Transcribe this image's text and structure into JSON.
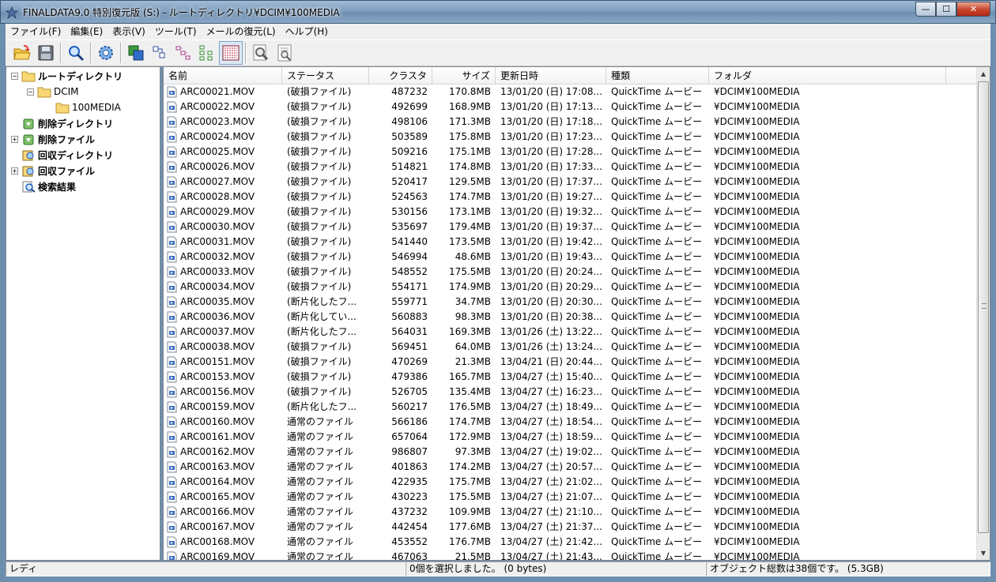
{
  "window": {
    "title": "FINALDATA9.0 特別復元版 (S:) - ルートディレクトリ¥DCIM¥100MEDIA",
    "controls": {
      "minimize": "—",
      "maximize": "☐",
      "close": "✕"
    }
  },
  "menu": [
    "ファイル(F)",
    "編集(E)",
    "表示(V)",
    "ツール(T)",
    "メールの復元(L)",
    "ヘルプ(H)"
  ],
  "toolbar": [
    {
      "icon": "open-folder-icon"
    },
    {
      "icon": "save-disk-icon"
    },
    {
      "icon": "search-magnifier-icon"
    },
    {
      "icon": "settings-gear-icon"
    },
    {
      "icon": "large-icons-view-icon"
    },
    {
      "icon": "small-icons-view-icon"
    },
    {
      "icon": "list-view-icon"
    },
    {
      "icon": "tree-view-icon"
    },
    {
      "icon": "details-view-icon"
    },
    {
      "icon": "preview-magnifier-icon"
    },
    {
      "icon": "file-preview-icon"
    }
  ],
  "tree": [
    {
      "label": "ルートディレクトリ",
      "expander": "−",
      "icon": "folder-icon"
    },
    {
      "label": "DCIM",
      "expander": "−",
      "icon": "folder-icon"
    },
    {
      "label": "100MEDIA",
      "expander": "",
      "icon": "folder-icon"
    },
    {
      "label": "削除ディレクトリ",
      "expander": "",
      "icon": "recycle-icon"
    },
    {
      "label": "削除ファイル",
      "expander": "+",
      "icon": "recycle-icon"
    },
    {
      "label": "回収ディレクトリ",
      "expander": "",
      "icon": "recover-icon"
    },
    {
      "label": "回収ファイル",
      "expander": "+",
      "icon": "recover-icon"
    },
    {
      "label": "検索結果",
      "expander": "",
      "icon": "search-result-icon"
    }
  ],
  "columns": [
    "名前",
    "ステータス",
    "クラスタ",
    "サイズ",
    "更新日時",
    "種類",
    "フォルダ"
  ],
  "rows": [
    [
      "ARC00021.MOV",
      "(破損ファイル)",
      "487232",
      "170.8MB",
      "13/01/20 (日) 17:08...",
      "QuickTime ムービー",
      "¥DCIM¥100MEDIA"
    ],
    [
      "ARC00022.MOV",
      "(破損ファイル)",
      "492699",
      "168.9MB",
      "13/01/20 (日) 17:13...",
      "QuickTime ムービー",
      "¥DCIM¥100MEDIA"
    ],
    [
      "ARC00023.MOV",
      "(破損ファイル)",
      "498106",
      "171.3MB",
      "13/01/20 (日) 17:18...",
      "QuickTime ムービー",
      "¥DCIM¥100MEDIA"
    ],
    [
      "ARC00024.MOV",
      "(破損ファイル)",
      "503589",
      "175.8MB",
      "13/01/20 (日) 17:23...",
      "QuickTime ムービー",
      "¥DCIM¥100MEDIA"
    ],
    [
      "ARC00025.MOV",
      "(破損ファイル)",
      "509216",
      "175.1MB",
      "13/01/20 (日) 17:28...",
      "QuickTime ムービー",
      "¥DCIM¥100MEDIA"
    ],
    [
      "ARC00026.MOV",
      "(破損ファイル)",
      "514821",
      "174.8MB",
      "13/01/20 (日) 17:33...",
      "QuickTime ムービー",
      "¥DCIM¥100MEDIA"
    ],
    [
      "ARC00027.MOV",
      "(破損ファイル)",
      "520417",
      "129.5MB",
      "13/01/20 (日) 17:37...",
      "QuickTime ムービー",
      "¥DCIM¥100MEDIA"
    ],
    [
      "ARC00028.MOV",
      "(破損ファイル)",
      "524563",
      "174.7MB",
      "13/01/20 (日) 19:27...",
      "QuickTime ムービー",
      "¥DCIM¥100MEDIA"
    ],
    [
      "ARC00029.MOV",
      "(破損ファイル)",
      "530156",
      "173.1MB",
      "13/01/20 (日) 19:32...",
      "QuickTime ムービー",
      "¥DCIM¥100MEDIA"
    ],
    [
      "ARC00030.MOV",
      "(破損ファイル)",
      "535697",
      "179.4MB",
      "13/01/20 (日) 19:37...",
      "QuickTime ムービー",
      "¥DCIM¥100MEDIA"
    ],
    [
      "ARC00031.MOV",
      "(破損ファイル)",
      "541440",
      "173.5MB",
      "13/01/20 (日) 19:42...",
      "QuickTime ムービー",
      "¥DCIM¥100MEDIA"
    ],
    [
      "ARC00032.MOV",
      "(破損ファイル)",
      "546994",
      "48.6MB",
      "13/01/20 (日) 19:43...",
      "QuickTime ムービー",
      "¥DCIM¥100MEDIA"
    ],
    [
      "ARC00033.MOV",
      "(破損ファイル)",
      "548552",
      "175.5MB",
      "13/01/20 (日) 20:24...",
      "QuickTime ムービー",
      "¥DCIM¥100MEDIA"
    ],
    [
      "ARC00034.MOV",
      "(破損ファイル)",
      "554171",
      "174.9MB",
      "13/01/20 (日) 20:29...",
      "QuickTime ムービー",
      "¥DCIM¥100MEDIA"
    ],
    [
      "ARC00035.MOV",
      "(断片化したフ...",
      "559771",
      "34.7MB",
      "13/01/20 (日) 20:30...",
      "QuickTime ムービー",
      "¥DCIM¥100MEDIA"
    ],
    [
      "ARC00036.MOV",
      "(断片化してい...",
      "560883",
      "98.3MB",
      "13/01/20 (日) 20:38...",
      "QuickTime ムービー",
      "¥DCIM¥100MEDIA"
    ],
    [
      "ARC00037.MOV",
      "(断片化したフ...",
      "564031",
      "169.3MB",
      "13/01/26 (土) 13:22...",
      "QuickTime ムービー",
      "¥DCIM¥100MEDIA"
    ],
    [
      "ARC00038.MOV",
      "(破損ファイル)",
      "569451",
      "64.0MB",
      "13/01/26 (土) 13:24...",
      "QuickTime ムービー",
      "¥DCIM¥100MEDIA"
    ],
    [
      "ARC00151.MOV",
      "(破損ファイル)",
      "470269",
      "21.3MB",
      "13/04/21 (日) 20:44...",
      "QuickTime ムービー",
      "¥DCIM¥100MEDIA"
    ],
    [
      "ARC00153.MOV",
      "(破損ファイル)",
      "479386",
      "165.7MB",
      "13/04/27 (土) 15:40...",
      "QuickTime ムービー",
      "¥DCIM¥100MEDIA"
    ],
    [
      "ARC00156.MOV",
      "(破損ファイル)",
      "526705",
      "135.4MB",
      "13/04/27 (土) 16:23...",
      "QuickTime ムービー",
      "¥DCIM¥100MEDIA"
    ],
    [
      "ARC00159.MOV",
      "(断片化したフ...",
      "560217",
      "176.5MB",
      "13/04/27 (土) 18:49...",
      "QuickTime ムービー",
      "¥DCIM¥100MEDIA"
    ],
    [
      "ARC00160.MOV",
      "通常のファイル",
      "566186",
      "174.7MB",
      "13/04/27 (土) 18:54...",
      "QuickTime ムービー",
      "¥DCIM¥100MEDIA"
    ],
    [
      "ARC00161.MOV",
      "通常のファイル",
      "657064",
      "172.9MB",
      "13/04/27 (土) 18:59...",
      "QuickTime ムービー",
      "¥DCIM¥100MEDIA"
    ],
    [
      "ARC00162.MOV",
      "通常のファイル",
      "986807",
      "97.3MB",
      "13/04/27 (土) 19:02...",
      "QuickTime ムービー",
      "¥DCIM¥100MEDIA"
    ],
    [
      "ARC00163.MOV",
      "通常のファイル",
      "401863",
      "174.2MB",
      "13/04/27 (土) 20:57...",
      "QuickTime ムービー",
      "¥DCIM¥100MEDIA"
    ],
    [
      "ARC00164.MOV",
      "通常のファイル",
      "422935",
      "175.7MB",
      "13/04/27 (土) 21:02...",
      "QuickTime ムービー",
      "¥DCIM¥100MEDIA"
    ],
    [
      "ARC00165.MOV",
      "通常のファイル",
      "430223",
      "175.5MB",
      "13/04/27 (土) 21:07...",
      "QuickTime ムービー",
      "¥DCIM¥100MEDIA"
    ],
    [
      "ARC00166.MOV",
      "通常のファイル",
      "437232",
      "109.9MB",
      "13/04/27 (土) 21:10...",
      "QuickTime ムービー",
      "¥DCIM¥100MEDIA"
    ],
    [
      "ARC00167.MOV",
      "通常のファイル",
      "442454",
      "177.6MB",
      "13/04/27 (土) 21:37...",
      "QuickTime ムービー",
      "¥DCIM¥100MEDIA"
    ],
    [
      "ARC00168.MOV",
      "通常のファイル",
      "453552",
      "176.7MB",
      "13/04/27 (土) 21:42...",
      "QuickTime ムービー",
      "¥DCIM¥100MEDIA"
    ],
    [
      "ARC00169.MOV",
      "通常のファイル",
      "467063",
      "21.5MB",
      "13/04/27 (土) 21:43...",
      "QuickTime ムービー",
      "¥DCIM¥100MEDIA"
    ]
  ],
  "status": {
    "ready": "レディ",
    "selection": "0個を選択しました。 (0 bytes)",
    "total": "オブジェクト総数は38個です。 (5.3GB)"
  },
  "colors": {
    "window_frame": "#6d8fae",
    "pane_bg": "#ffffff",
    "chrome": "#f0f0f0"
  }
}
